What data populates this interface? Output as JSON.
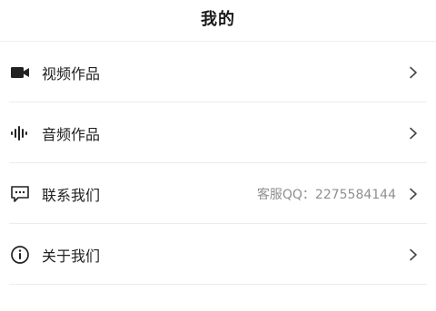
{
  "header": {
    "title": "我的"
  },
  "menu": {
    "items": [
      {
        "label": "视频作品",
        "icon": "video-camera-icon"
      },
      {
        "label": "音频作品",
        "icon": "audio-waveform-icon"
      },
      {
        "label": "联系我们",
        "icon": "message-icon",
        "value": "客服QQ：2275584144"
      },
      {
        "label": "关于我们",
        "icon": "info-icon"
      }
    ]
  },
  "colors": {
    "text": "#222222",
    "secondary_text": "#8f8f8f",
    "divider": "#ececec",
    "icon": "#222222"
  }
}
